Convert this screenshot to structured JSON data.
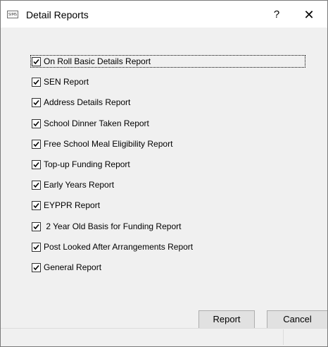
{
  "window": {
    "title": "Detail Reports",
    "app_icon_label": "SIMS",
    "help_glyph": "?",
    "close_glyph": "✕"
  },
  "reports": [
    {
      "label": "On Roll Basic Details Report",
      "checked": true,
      "focused": true
    },
    {
      "label": "SEN Report",
      "checked": true
    },
    {
      "label": "Address Details Report",
      "checked": true
    },
    {
      "label": "School Dinner Taken Report",
      "checked": true
    },
    {
      "label": "Free School Meal Eligibility Report",
      "checked": true
    },
    {
      "label": "Top-up Funding Report",
      "checked": true
    },
    {
      "label": "Early Years Report",
      "checked": true
    },
    {
      "label": "EYPPR Report",
      "checked": true
    },
    {
      "label": " 2 Year Old Basis for Funding Report",
      "checked": true
    },
    {
      "label": "Post Looked After Arrangements Report",
      "checked": true
    },
    {
      "label": "General Report",
      "checked": true
    }
  ],
  "buttons": {
    "report_label": "Report",
    "cancel_label": "Cancel"
  },
  "colors": {
    "window_bg": "#f0f0f0",
    "titlebar_bg": "#ffffff",
    "button_bg": "#e1e1e1",
    "button_border": "#adadad"
  }
}
